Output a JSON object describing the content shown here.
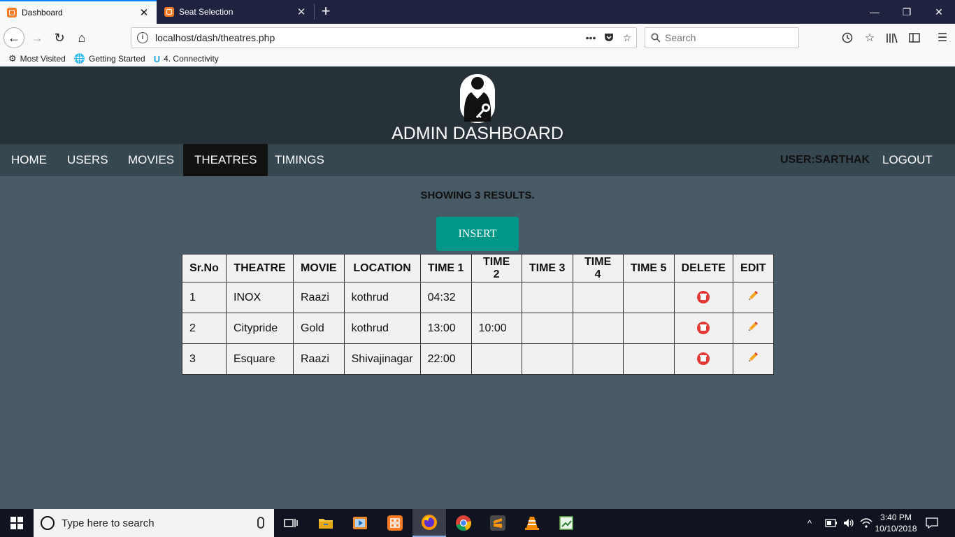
{
  "browser": {
    "tabs": [
      {
        "title": "Dashboard",
        "active": true
      },
      {
        "title": "Seat Selection",
        "active": false
      }
    ],
    "url": "localhost/dash/theatres.php",
    "search_placeholder": "Search",
    "url_more": "•••",
    "bookmarks": [
      "Most Visited",
      "Getting Started",
      "4. Connectivity"
    ]
  },
  "header": {
    "title": "ADMIN DASHBOARD"
  },
  "menu": {
    "items": [
      "HOME",
      "USERS",
      "MOVIES",
      "THEATRES",
      "TIMINGS"
    ],
    "active": "THEATRES",
    "user_label": "USER:SARTHAK",
    "logout": "LOGOUT"
  },
  "results_text": "SHOWING 3 RESULTS.",
  "insert_label": "INSERT",
  "table": {
    "headers": [
      "Sr.No",
      "THEATRE",
      "MOVIE",
      "LOCATION",
      "TIME 1",
      "TIME 2",
      "TIME 3",
      "TIME 4",
      "TIME 5",
      "DELETE",
      "EDIT"
    ],
    "rows": [
      [
        "1",
        "INOX",
        "Raazi",
        "kothrud",
        "04:32",
        "",
        "",
        "",
        ""
      ],
      [
        "2",
        "Citypride",
        "Gold",
        "kothrud",
        "13:00",
        "10:00",
        "",
        "",
        ""
      ],
      [
        "3",
        "Esquare",
        "Raazi",
        "Shivajinagar",
        "22:00",
        "",
        "",
        "",
        ""
      ]
    ]
  },
  "taskbar": {
    "search_placeholder": "Type here to search",
    "time": "3:40 PM",
    "date": "10/10/2018"
  },
  "colors": {
    "page_bg": "#475a66",
    "header_bg": "#263238",
    "menu_bg": "#37474f",
    "menu_active_bg": "#121212",
    "insert_bg": "#009688",
    "delete_red": "#e53935",
    "edit_orange": "#f5a623"
  }
}
